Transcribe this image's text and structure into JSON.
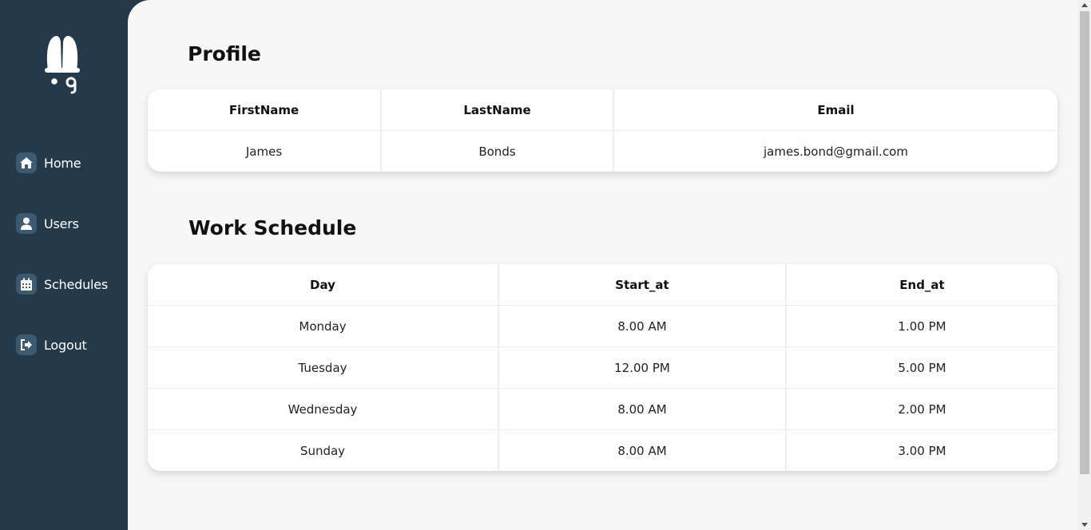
{
  "sidebar": {
    "logo_icon": "bell-logo-icon",
    "items": [
      {
        "label": "Home",
        "icon": "home-icon"
      },
      {
        "label": "Users",
        "icon": "user-icon"
      },
      {
        "label": "Schedules",
        "icon": "calendar-icon"
      },
      {
        "label": "Logout",
        "icon": "logout-icon"
      }
    ]
  },
  "profile": {
    "title": "Profile",
    "columns": [
      "FirstName",
      "LastName",
      "Email"
    ],
    "row": [
      "James",
      "Bonds",
      "james.bond@gmail.com"
    ]
  },
  "schedule": {
    "title": "Work Schedule",
    "columns": [
      "Day",
      "Start_at",
      "End_at"
    ],
    "rows": [
      [
        "Monday",
        "8.00 AM",
        "1.00 PM"
      ],
      [
        "Tuesday",
        "12.00 PM",
        "5.00 PM"
      ],
      [
        "Wednesday",
        "8.00 AM",
        "2.00 PM"
      ],
      [
        "Sunday",
        "8.00 AM",
        "3.00 PM"
      ]
    ]
  },
  "colors": {
    "sidebar_bg": "#243a4b",
    "icon_bg": "#3d5a70",
    "content_bg": "#f7f7f7",
    "card_bg": "#ffffff"
  }
}
